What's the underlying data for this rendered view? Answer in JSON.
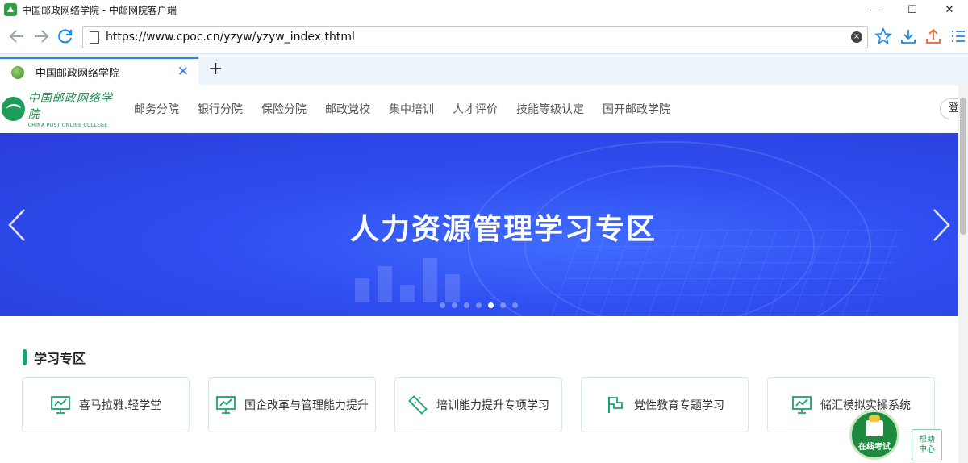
{
  "window": {
    "title": "中国邮政网络学院 - 中邮网院客户端",
    "minimize": "—",
    "maximize": "☐",
    "close": "✕"
  },
  "address": {
    "url": "https://www.cpoc.cn/yzyw/yzyw_index.thtml",
    "clear_label": "×"
  },
  "tab": {
    "title": "中国邮政网络学院",
    "close_label": "✕",
    "new_tab_label": "+"
  },
  "site": {
    "logo_cn": "中国邮政网络学院",
    "logo_en": "CHINA POST ONLINE COLLEGE",
    "nav": [
      "邮务分院",
      "银行分院",
      "保险分院",
      "邮政党校",
      "集中培训",
      "人才评价",
      "技能等级认定",
      "国开邮政学院"
    ],
    "login_label": "登"
  },
  "banner": {
    "title": "人力资源管理学习专区",
    "slide_count": 7,
    "active_slide": 5
  },
  "zone": {
    "title": "学习专区",
    "cards": [
      {
        "label": "喜马拉雅.轻学堂",
        "icon": "presentation-chart-icon"
      },
      {
        "label": "国企改革与管理能力提升",
        "icon": "presentation-chart-icon"
      },
      {
        "label": "培训能力提升专项学习",
        "icon": "ruler-icon"
      },
      {
        "label": "党性教育专题学习",
        "icon": "flag-icon"
      },
      {
        "label": "储汇模拟实操系统",
        "icon": "presentation-chart-icon"
      }
    ]
  },
  "floating": {
    "exam_label": "在线考试",
    "help_line1": "帮助",
    "help_line2": "中心"
  },
  "colors": {
    "accent_green": "#19a46e",
    "banner_blue": "#2f4df0",
    "browser_blue": "#1e88e5"
  }
}
